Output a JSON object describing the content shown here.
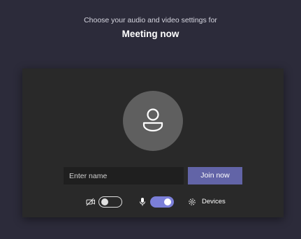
{
  "header": {
    "subtitle": "Choose your audio and video settings for",
    "title": "Meeting now"
  },
  "join_form": {
    "name_placeholder": "Enter name",
    "name_value": "",
    "join_button_label": "Join now"
  },
  "controls": {
    "camera_icon": "camera-off-icon",
    "camera_toggle_on": false,
    "mic_icon": "microphone-icon",
    "mic_toggle_on": true,
    "devices_icon": "gear-icon",
    "devices_label": "Devices"
  },
  "colors": {
    "background": "#2c2b3a",
    "panel": "#292929",
    "accent": "#6264a7",
    "toggle_on": "#7b7fd8",
    "avatar": "#5f5f5f"
  }
}
